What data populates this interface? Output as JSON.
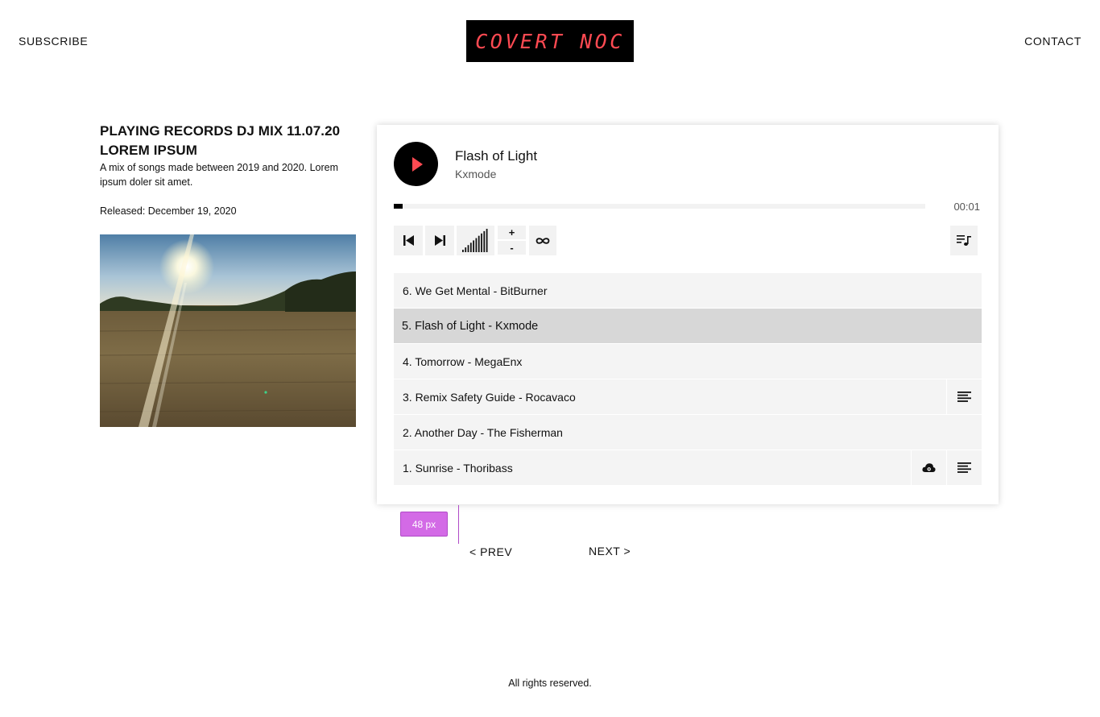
{
  "header": {
    "subscribe_label": "SUBSCRIBE",
    "logo_text": "COVERT NOC",
    "contact_label": "CONTACT",
    "logo_color": "#ff4a52"
  },
  "release": {
    "title": "PLAYING RECORDS DJ MIX 11.07.20 LOREM IPSUM",
    "description": "A mix of songs made between 2019 and 2020. Lorem ipsum doler sit amet.",
    "released": "Released: December 19, 2020"
  },
  "player": {
    "now_playing": {
      "title": "Flash of Light",
      "artist": "Kxmode"
    },
    "elapsed": "00:01",
    "progress_fraction": 0.016,
    "volume_level": 10,
    "volume_max": 10,
    "volume_up_label": "+",
    "volume_down_label": "-",
    "accent_color": "#ff4a52",
    "tracks": [
      {
        "label": "6. We Get Mental - BitBurner",
        "active": false,
        "lyrics": false,
        "download": false
      },
      {
        "label": "5. Flash of Light - Kxmode",
        "active": true,
        "lyrics": false,
        "download": false
      },
      {
        "label": "4. Tomorrow - MegaEnx",
        "active": false,
        "lyrics": false,
        "download": false
      },
      {
        "label": "3. Remix Safety Guide - Rocavaco",
        "active": false,
        "lyrics": true,
        "download": false
      },
      {
        "label": "2. Another Day - The Fisherman",
        "active": false,
        "lyrics": false,
        "download": false
      },
      {
        "label": "1. Sunrise - Thoribass",
        "active": false,
        "lyrics": true,
        "download": true
      }
    ]
  },
  "overlay": {
    "measure_label": "48 px"
  },
  "pagination": {
    "prev_label": "< PREV",
    "next_label": "NEXT >"
  },
  "footer": {
    "text": "All rights reserved."
  }
}
